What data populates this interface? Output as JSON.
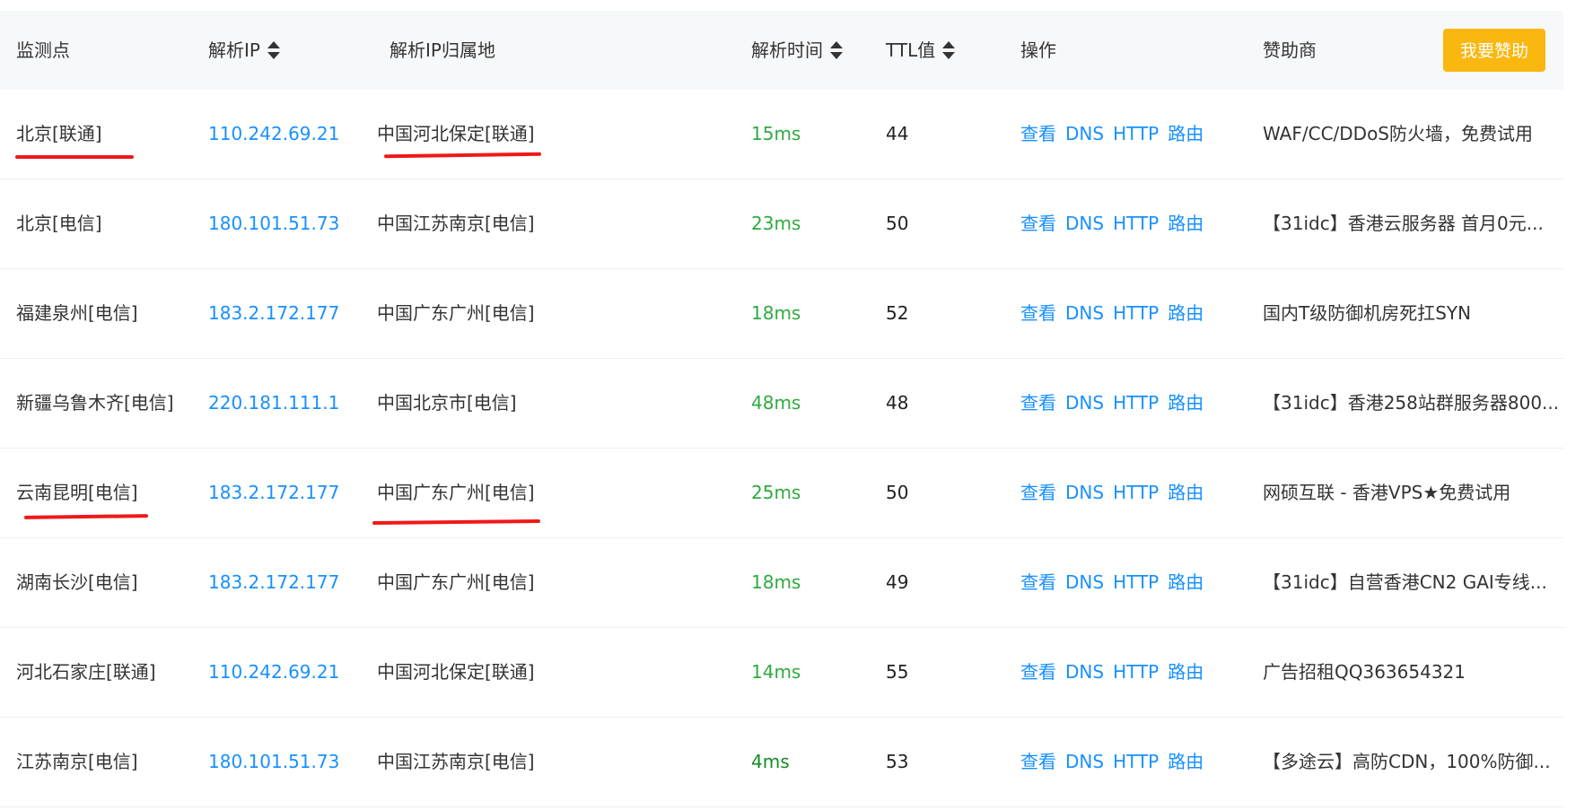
{
  "header": {
    "monitor_point": "监测点",
    "resolved_ip": "解析IP",
    "ip_location": "解析IP归属地",
    "resolve_time": "解析时间",
    "ttl": "TTL值",
    "operations": "操作",
    "sponsor": "赞助商",
    "sponsor_button": "我要赞助"
  },
  "ops_labels": {
    "view": "查看",
    "dns": "DNS",
    "http": "HTTP",
    "route": "路由"
  },
  "rows": [
    {
      "point": "北京[联通]",
      "ip": "110.242.69.21",
      "location": "中国河北保定[联通]",
      "time": "15ms",
      "ttl": "44",
      "sponsor": "WAF/CC/DDoS防火墙，免费试用"
    },
    {
      "point": "北京[电信]",
      "ip": "180.101.51.73",
      "location": "中国江苏南京[电信]",
      "time": "23ms",
      "ttl": "50",
      "sponsor": "【31idc】香港云服务器 首月0元..."
    },
    {
      "point": "福建泉州[电信]",
      "ip": "183.2.172.177",
      "location": "中国广东广州[电信]",
      "time": "18ms",
      "ttl": "52",
      "sponsor": "国内T级防御机房死扛SYN"
    },
    {
      "point": "新疆乌鲁木齐[电信]",
      "ip": "220.181.111.1",
      "location": "中国北京市[电信]",
      "time": "48ms",
      "ttl": "48",
      "sponsor": "【31idc】香港258站群服务器800..."
    },
    {
      "point": "云南昆明[电信]",
      "ip": "183.2.172.177",
      "location": "中国广东广州[电信]",
      "time": "25ms",
      "ttl": "50",
      "sponsor": "网硕互联 - 香港VPS★免费试用"
    },
    {
      "point": "湖南长沙[电信]",
      "ip": "183.2.172.177",
      "location": "中国广东广州[电信]",
      "time": "18ms",
      "ttl": "49",
      "sponsor": "【31idc】自营香港CN2 GAI专线..."
    },
    {
      "point": "河北石家庄[联通]",
      "ip": "110.242.69.21",
      "location": "中国河北保定[联通]",
      "time": "14ms",
      "ttl": "55",
      "sponsor": "广告招租QQ363654321"
    },
    {
      "point": "江苏南京[电信]",
      "ip": "180.101.51.73",
      "location": "中国江苏南京[电信]",
      "time": "4ms",
      "ttl": "53",
      "sponsor": "【多途云】高防CDN，100%防御..."
    }
  ],
  "colors": {
    "link_blue": "#1890ff",
    "time_green": "#2eaa3e",
    "sponsor_button_yellow": "#f9b70f",
    "header_bg": "#f7f8fa",
    "annotation_red": "#f01818"
  }
}
